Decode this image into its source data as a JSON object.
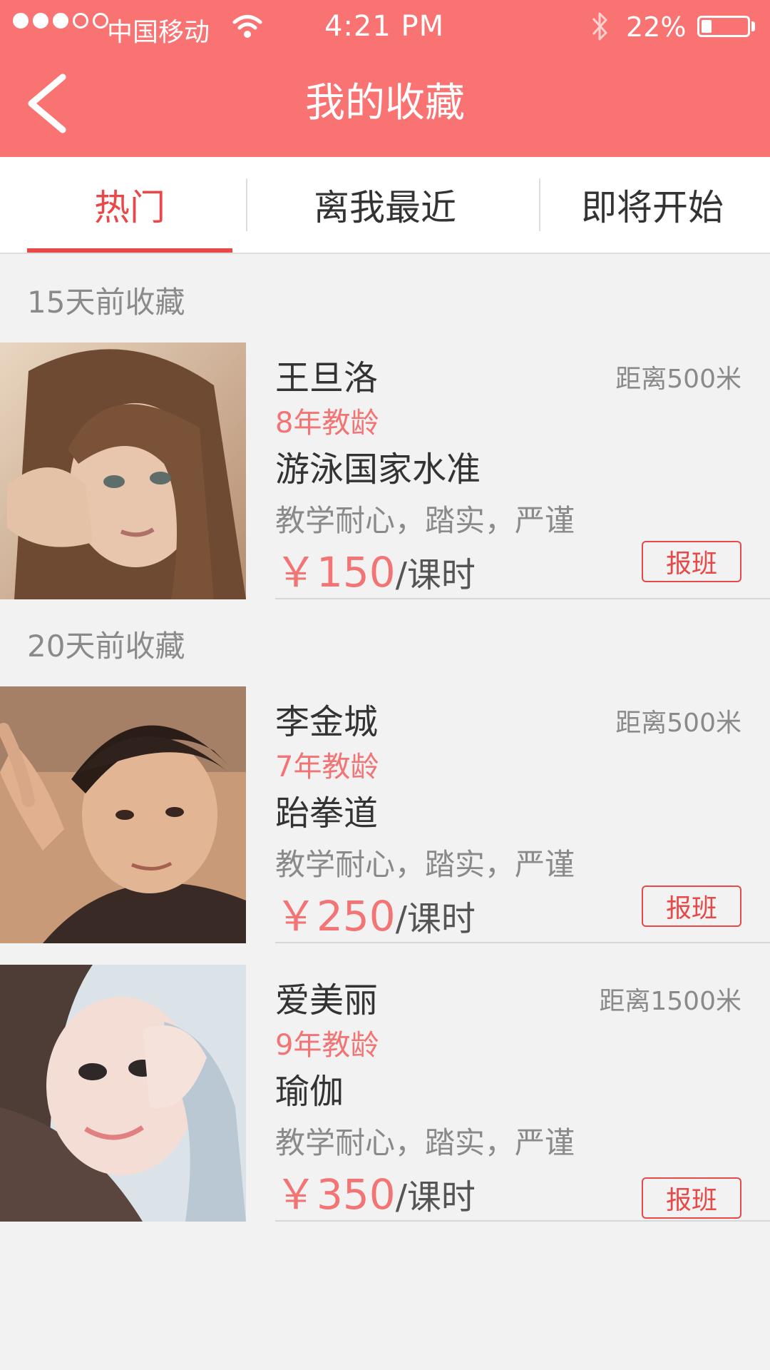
{
  "status_bar": {
    "carrier": "中国移动",
    "time": "4:21 PM",
    "battery_percent": "22%",
    "battery_level": 0.22,
    "signal_bars": 3,
    "signal_total": 5,
    "icons": [
      "wifi-icon",
      "bluetooth-icon",
      "battery-icon"
    ]
  },
  "header": {
    "back_icon": "chevron-left-icon",
    "title": "我的收藏"
  },
  "tabs": [
    {
      "label": "热门",
      "active": true
    },
    {
      "label": "离我最近",
      "active": false
    },
    {
      "label": "即将开始",
      "active": false
    }
  ],
  "colors": {
    "header": "#f97373",
    "accent": "#e84848",
    "price": "#f27474",
    "background": "#f2f2f2"
  },
  "sections": [
    {
      "label": "15天前收藏"
    },
    {
      "label": "20天前收藏"
    }
  ],
  "teachers": [
    {
      "name": "王旦洛",
      "distance": "距离500米",
      "experience": "8年教龄",
      "subject": "游泳国家水准",
      "tags": "教学耐心，踏实，严谨",
      "price": "￥150",
      "price_unit": "/课时",
      "enroll_label": "报班"
    },
    {
      "name": "李金城",
      "distance": "距离500米",
      "experience": "7年教龄",
      "subject": "跆拳道",
      "tags": "教学耐心，踏实，严谨",
      "price": "￥250",
      "price_unit": "/课时",
      "enroll_label": "报班"
    },
    {
      "name": "爱美丽",
      "distance": "距离1500米",
      "experience": "9年教龄",
      "subject": "瑜伽",
      "tags": "教学耐心，踏实，严谨",
      "price": "￥350",
      "price_unit": "/课时",
      "enroll_label": "报班"
    }
  ]
}
